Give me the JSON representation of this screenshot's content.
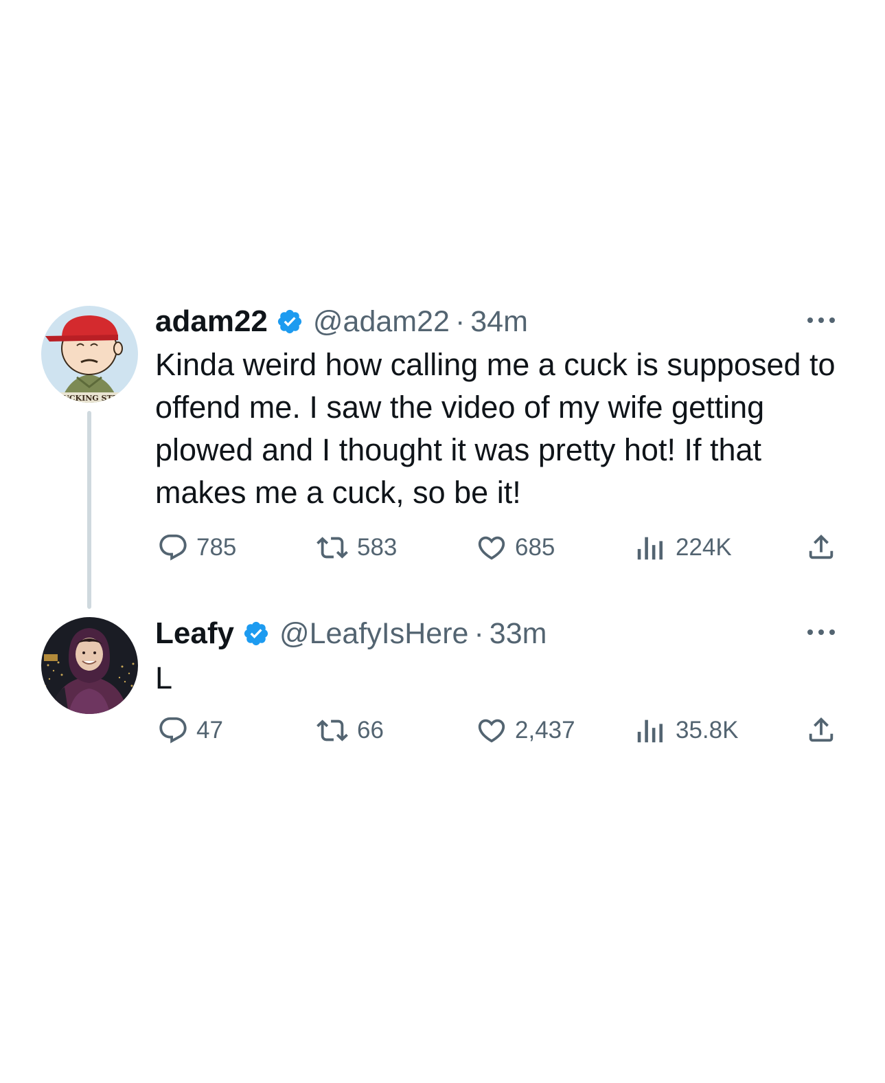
{
  "tweets": [
    {
      "display_name": "adam22",
      "handle": "@adam22",
      "separator": "·",
      "time": "34m",
      "verified": true,
      "avatar_icon": "cartoon-boy-red-cap-avatar",
      "avatar_caption": "UCKING STI",
      "text": "Kinda weird how calling me a cuck is supposed to offend me. I saw the video of my wife getting plowed and I thought it was pretty hot! If that makes me a cuck, so be it!",
      "stats": {
        "replies": "785",
        "reposts": "583",
        "likes": "685",
        "views": "224K"
      }
    },
    {
      "display_name": "Leafy",
      "handle": "@LeafyIsHere",
      "separator": "·",
      "time": "33m",
      "verified": true,
      "avatar_icon": "person-in-hoodie-city-night-avatar",
      "text": "L",
      "stats": {
        "replies": "47",
        "reposts": "66",
        "likes": "2,437",
        "views": "35.8K"
      }
    }
  ],
  "colors": {
    "text_primary": "#0f1419",
    "text_secondary": "#536471",
    "verified_blue": "#1d9bf0",
    "thread_line": "#cfd9de",
    "background": "#ffffff"
  },
  "icons": {
    "reply": "reply-icon",
    "repost": "repost-icon",
    "like": "like-icon",
    "views": "views-icon",
    "share": "share-icon",
    "more": "more-icon",
    "verified": "verified-badge-icon"
  }
}
